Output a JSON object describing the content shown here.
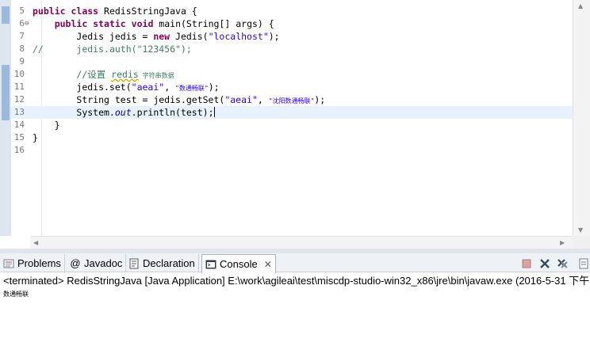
{
  "editor": {
    "lines": {
      "l5": {
        "num": "5",
        "kw1": "public",
        "kw2": "class",
        "rest": " RedisStringJava {"
      },
      "l6": {
        "num": "6",
        "fold": "⊖",
        "kw1": "public",
        "kw2": "static",
        "kw3": "void",
        "rest": " main(String[] args) {"
      },
      "l7": {
        "num": "7",
        "pre": "Jedis jedis = ",
        "kw": "new",
        "mid": " Jedis(",
        "str": "\"localhost\"",
        "post": ");"
      },
      "l8": {
        "num": "8",
        "comment_prefix": "//",
        "comment_body": "jedis.auth(\"123456\");"
      },
      "l9": {
        "num": "9"
      },
      "l10": {
        "num": "10",
        "comment_a": "//设置 ",
        "comment_word": "redis",
        "comment_b": " 字符串数据"
      },
      "l11": {
        "num": "11",
        "pre": "jedis.set(",
        "str1": "\"aeai\"",
        "mid": ", ",
        "str2": "\"数通畅联\"",
        "post": ");"
      },
      "l12": {
        "num": "12",
        "pre": "String test = jedis.getSet(",
        "str1": "\"aeai\"",
        "mid": ", ",
        "str2": "\"沈阳数通畅联\"",
        "post": ");"
      },
      "l13": {
        "num": "13",
        "pre": "System.",
        "field": "out",
        "post": ".println(test);"
      },
      "l14": {
        "num": "14",
        "text": "}"
      },
      "l15": {
        "num": "15",
        "text": "}"
      },
      "l16": {
        "num": "16"
      }
    }
  },
  "panel": {
    "tabs": {
      "problems": "Problems",
      "javadoc": "Javadoc",
      "declaration": "Declaration",
      "console": "Console"
    },
    "console": {
      "header": "<terminated> RedisStringJava [Java Application] E:\\work\\agileai\\test\\miscdp-studio-win32_x86\\jre\\bin\\javaw.exe (2016-5-31 下午",
      "output": "数通畅联"
    }
  },
  "colors": {
    "keyword": "#7f0055",
    "string": "#2a00ff",
    "comment": "#3f7f5f",
    "static_field": "#0000c0",
    "current_line": "#e8f2fe"
  }
}
